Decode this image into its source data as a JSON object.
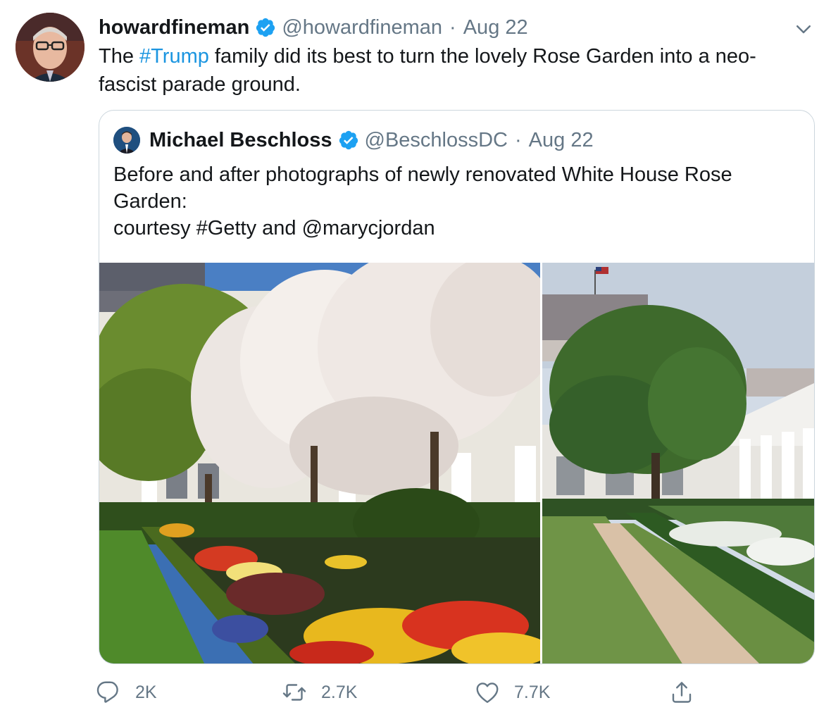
{
  "tweet": {
    "display_name": "howardfineman",
    "handle": "@howardfineman",
    "separator": "·",
    "date": "Aug 22",
    "text_before": "The ",
    "hashtag": "#Trump",
    "text_line1_after": " family did its best to turn the lovely Rose Garden into a neo-",
    "text_line2": "fascist parade ground.",
    "icons": {
      "verified": "verified-badge-icon",
      "menu": "chevron-down-icon"
    }
  },
  "quote": {
    "display_name": "Michael Beschloss",
    "handle": "@BeschlossDC",
    "separator": "·",
    "date": "Aug 22",
    "lines": [
      "Before and after photographs of newly renovated White House Rose",
      "Garden:",
      "courtesy #Getty and @marycjordan"
    ]
  },
  "actions": {
    "reply_count": "2K",
    "retweet_count": "2.7K",
    "like_count": "7.7K",
    "icons": [
      "reply-icon",
      "retweet-icon",
      "like-icon",
      "share-icon"
    ]
  },
  "colors": {
    "accent": "#1b95e0",
    "verified": "#1da1f2",
    "secondary_text": "#657786",
    "border": "#ccd6dd"
  }
}
